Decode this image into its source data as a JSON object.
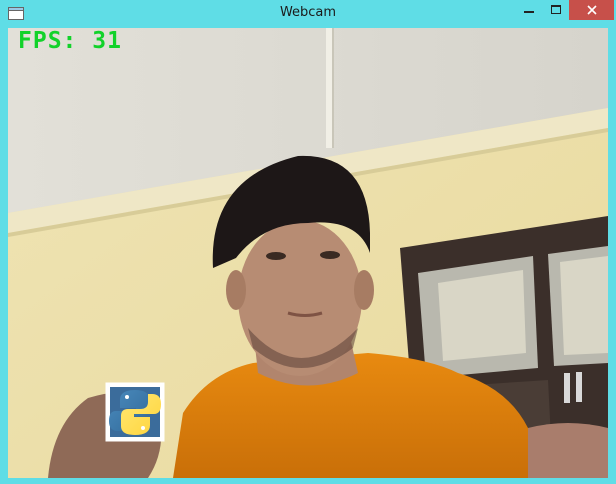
{
  "window": {
    "title": "Webcam",
    "controls": {
      "minimize_icon": "minimize-icon",
      "maximize_icon": "maximize-icon",
      "close_icon": "close-icon",
      "close_color": "#c7504a"
    },
    "frame_color": "#5fdde6"
  },
  "overlay": {
    "fps_text": "FPS: 31",
    "fps_color": "#12d22a",
    "logo": "python-logo-icon",
    "box_color": "#ffffff"
  }
}
